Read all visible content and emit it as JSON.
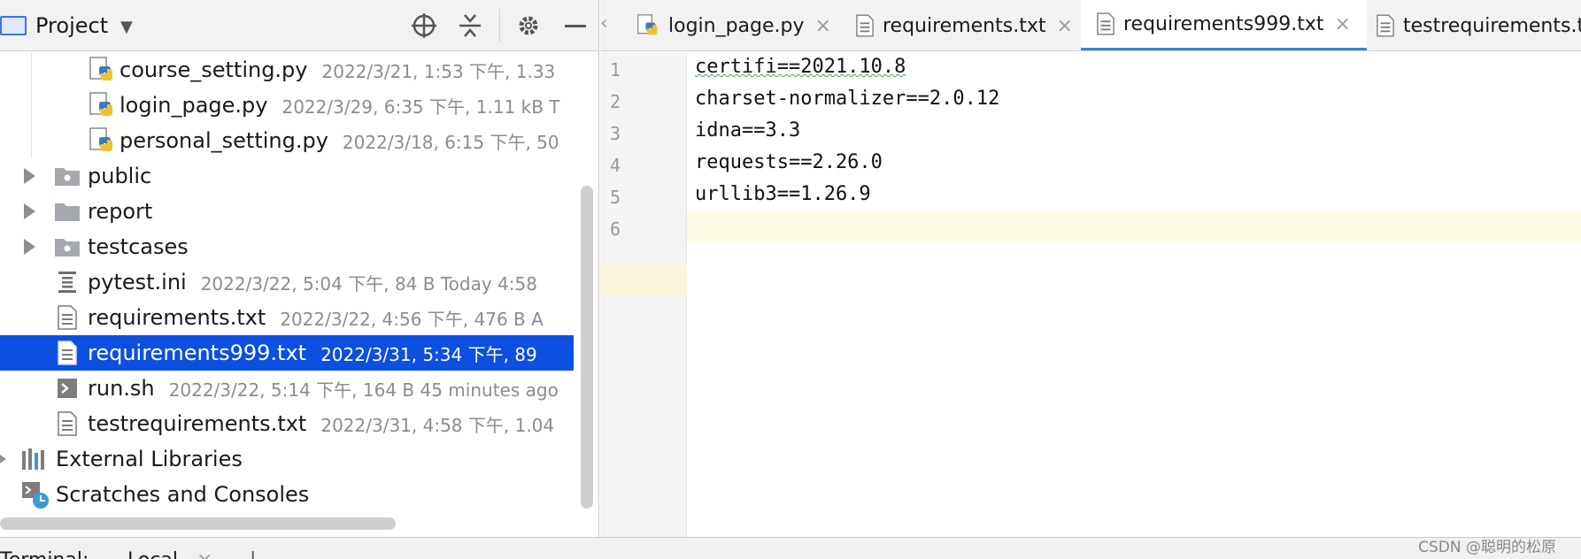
{
  "project_panel": {
    "title": "Project",
    "tree": [
      {
        "name": "course_setting.py",
        "meta": "2022/3/21, 1:53 下午, 1.33",
        "icon": "python-file-icon"
      },
      {
        "name": "login_page.py",
        "meta": "2022/3/29, 6:35 下午, 1.11 kB T",
        "icon": "python-file-icon"
      },
      {
        "name": "personal_setting.py",
        "meta": "2022/3/18, 6:15 下午, 50",
        "icon": "python-file-icon"
      },
      {
        "name": "public",
        "meta": "",
        "icon": "package-folder-icon"
      },
      {
        "name": "report",
        "meta": "",
        "icon": "folder-icon"
      },
      {
        "name": "testcases",
        "meta": "",
        "icon": "package-folder-icon"
      },
      {
        "name": "pytest.ini",
        "meta": "2022/3/22, 5:04 下午, 84 B Today 4:58",
        "icon": "ini-file-icon"
      },
      {
        "name": "requirements.txt",
        "meta": "2022/3/22, 4:56 下午, 476 B A",
        "icon": "text-file-icon"
      },
      {
        "name": "requirements999.txt",
        "meta": "2022/3/31, 5:34 下午, 89",
        "icon": "text-file-icon"
      },
      {
        "name": "run.sh",
        "meta": "2022/3/22, 5:14 下午, 164 B 45 minutes ago",
        "icon": "shell-file-icon"
      },
      {
        "name": "testrequirements.txt",
        "meta": "2022/3/31, 4:58 下午, 1.04",
        "icon": "text-file-icon"
      },
      {
        "name": "External Libraries",
        "meta": "",
        "icon": "libraries-icon"
      },
      {
        "name": "Scratches and Consoles",
        "meta": "",
        "icon": "scratches-icon"
      }
    ]
  },
  "editor": {
    "tabs": [
      {
        "label": "login_page.py",
        "icon": "python-file-icon"
      },
      {
        "label": "requirements.txt",
        "icon": "text-file-icon"
      },
      {
        "label": "requirements999.txt",
        "icon": "text-file-icon"
      },
      {
        "label": "testrequirements.txt",
        "icon": "text-file-icon"
      }
    ],
    "active_tab": "requirements999.txt",
    "line_numbers": [
      "1",
      "2",
      "3",
      "4",
      "5",
      "6"
    ],
    "lines": [
      "certifi==2021.10.8",
      "charset-normalizer==2.0.12",
      "idna==3.3",
      "requests==2.26.0",
      "urllib3==1.26.9",
      ""
    ]
  },
  "bottom": {
    "terminal_label": "Terminal:",
    "local_label": "Local"
  },
  "watermark": "CSDN @聪明的松原",
  "colors": {
    "selection": "#0d4fe0",
    "active_tab_underline": "#4083c9",
    "current_line": "#fefbe4"
  }
}
